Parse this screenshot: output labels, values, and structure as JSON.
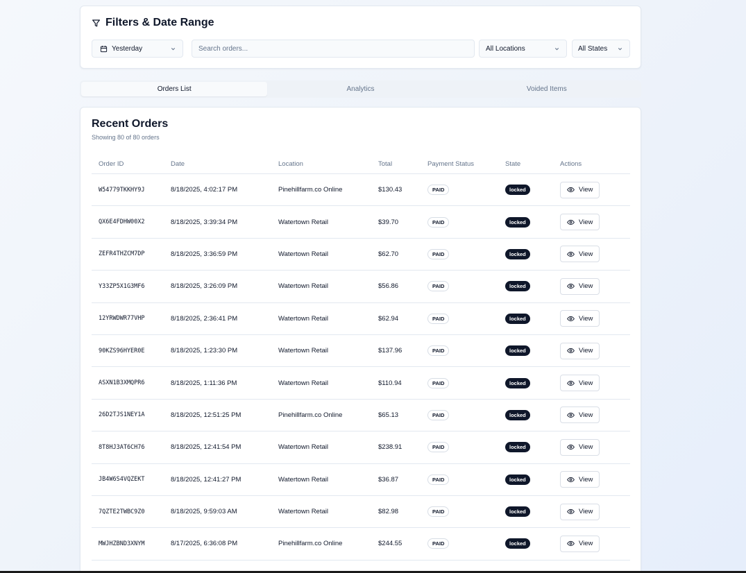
{
  "filters": {
    "title": "Filters & Date Range",
    "date_range": "Yesterday",
    "search_placeholder": "Search orders...",
    "location": "All Locations",
    "state": "All States"
  },
  "tabs": [
    {
      "label": "Orders List",
      "active": true
    },
    {
      "label": "Analytics",
      "active": false
    },
    {
      "label": "Voided Items",
      "active": false
    }
  ],
  "orders": {
    "title": "Recent Orders",
    "subtitle": "Showing 80 of 80 orders",
    "columns": [
      "Order ID",
      "Date",
      "Location",
      "Total",
      "Payment Status",
      "State",
      "Actions"
    ],
    "view_label": "View",
    "rows": [
      {
        "id": "W54779TKKHY9J",
        "date": "8/18/2025, 4:02:17 PM",
        "location": "Pinehillfarm.co Online",
        "total": "$130.43",
        "payment": "PAID",
        "state": "locked"
      },
      {
        "id": "QX6E4FDHW00X2",
        "date": "8/18/2025, 3:39:34 PM",
        "location": "Watertown Retail",
        "total": "$39.70",
        "payment": "PAID",
        "state": "locked"
      },
      {
        "id": "ZEFR4THZCM7DP",
        "date": "8/18/2025, 3:36:59 PM",
        "location": "Watertown Retail",
        "total": "$62.70",
        "payment": "PAID",
        "state": "locked"
      },
      {
        "id": "Y33ZP5X1G3MF6",
        "date": "8/18/2025, 3:26:09 PM",
        "location": "Watertown Retail",
        "total": "$56.86",
        "payment": "PAID",
        "state": "locked"
      },
      {
        "id": "12YRWDWR77VHP",
        "date": "8/18/2025, 2:36:41 PM",
        "location": "Watertown Retail",
        "total": "$62.94",
        "payment": "PAID",
        "state": "locked"
      },
      {
        "id": "90KZS96HYER0E",
        "date": "8/18/2025, 1:23:30 PM",
        "location": "Watertown Retail",
        "total": "$137.96",
        "payment": "PAID",
        "state": "locked"
      },
      {
        "id": "ASXN1B3XMQPR6",
        "date": "8/18/2025, 1:11:36 PM",
        "location": "Watertown Retail",
        "total": "$110.94",
        "payment": "PAID",
        "state": "locked"
      },
      {
        "id": "26D2TJS1NEY1A",
        "date": "8/18/2025, 12:51:25 PM",
        "location": "Pinehillfarm.co Online",
        "total": "$65.13",
        "payment": "PAID",
        "state": "locked"
      },
      {
        "id": "8T8HJ3AT6CH76",
        "date": "8/18/2025, 12:41:54 PM",
        "location": "Watertown Retail",
        "total": "$238.91",
        "payment": "PAID",
        "state": "locked"
      },
      {
        "id": "JB4W6S4VQZEKT",
        "date": "8/18/2025, 12:41:27 PM",
        "location": "Watertown Retail",
        "total": "$36.87",
        "payment": "PAID",
        "state": "locked"
      },
      {
        "id": "7QZTE2TWBC9Z0",
        "date": "8/18/2025, 9:59:03 AM",
        "location": "Watertown Retail",
        "total": "$82.98",
        "payment": "PAID",
        "state": "locked"
      },
      {
        "id": "MWJHZBND3XNYM",
        "date": "8/17/2025, 6:36:08 PM",
        "location": "Pinehillfarm.co Online",
        "total": "$244.55",
        "payment": "PAID",
        "state": "locked"
      }
    ]
  }
}
